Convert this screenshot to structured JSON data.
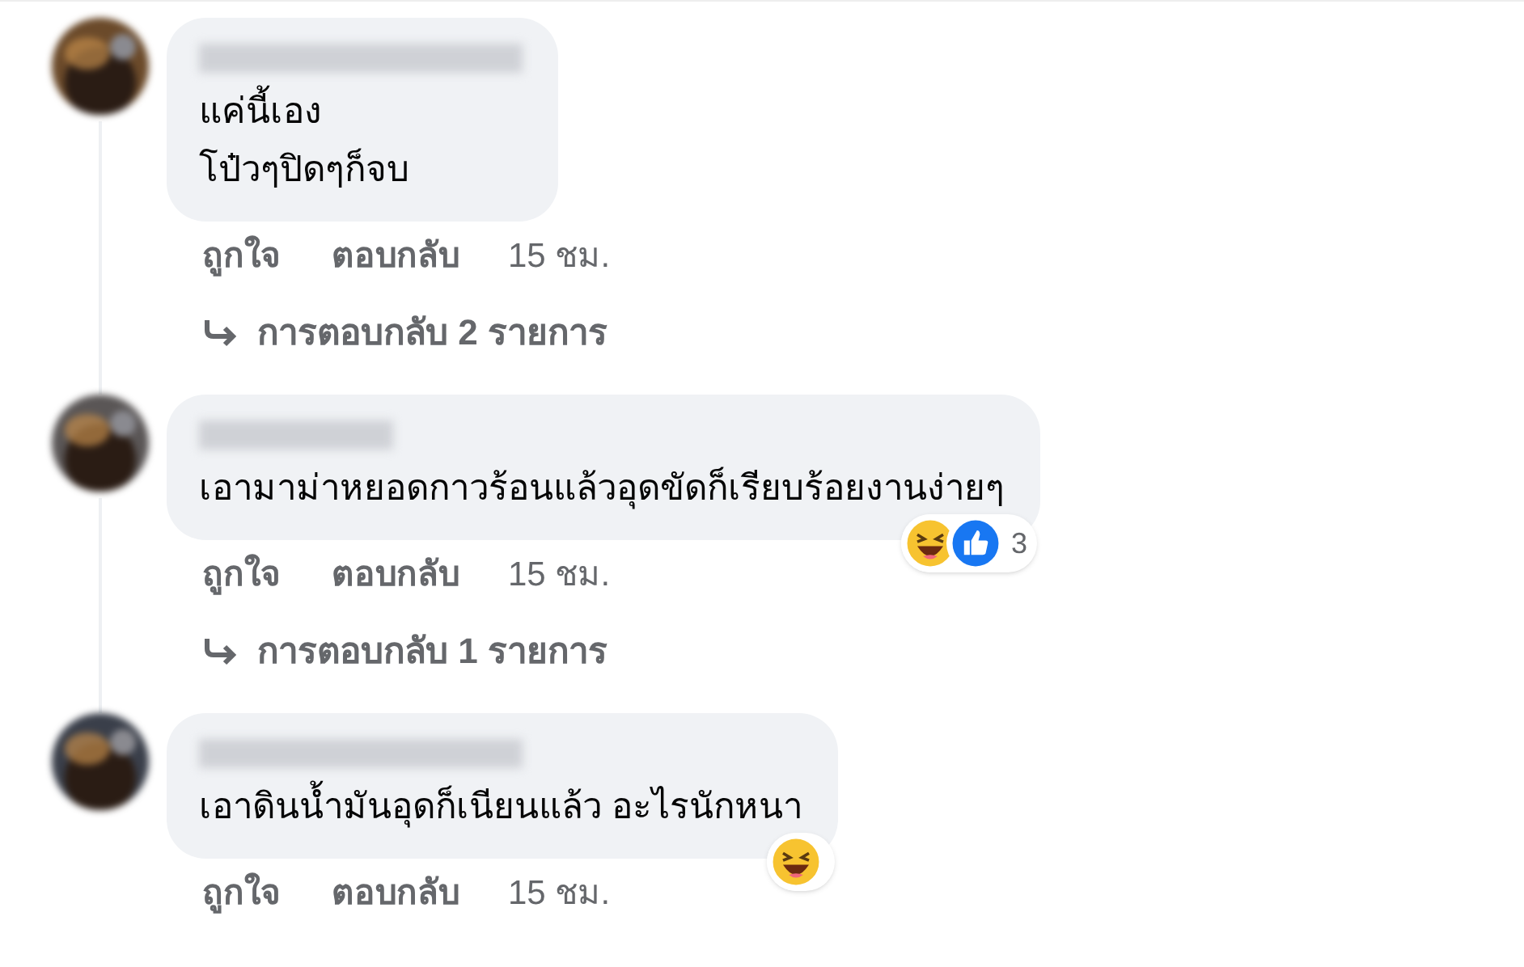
{
  "comments": [
    {
      "lines": [
        "แค่นี้เอง",
        "โป๋วๆปิดๆก็จบ"
      ],
      "actions": [
        "ถูกใจ",
        "ตอบกลับ"
      ],
      "time": "15 ชม.",
      "replies": "การตอบกลับ 2 รายการ"
    },
    {
      "lines": [
        "เอามาม่าหยอดกาวร้อนแล้วอุดขัดก็เรียบร้อยงานง่ายๆ"
      ],
      "reactions": [
        {
          "kind": "haha"
        },
        {
          "kind": "like"
        }
      ],
      "reaction_count": "3",
      "actions": [
        "ถูกใจ",
        "ตอบกลับ"
      ],
      "time": "15 ชม.",
      "replies": "การตอบกลับ 1 รายการ"
    },
    {
      "lines": [
        "เอาดินน้ำมันอุดก็เนียนแล้ว อะไรนักหนา"
      ],
      "reactions": [
        {
          "kind": "haha"
        }
      ],
      "actions": [
        "ถูกใจ",
        "ตอบกลับ"
      ],
      "time": "15 ชม."
    }
  ]
}
